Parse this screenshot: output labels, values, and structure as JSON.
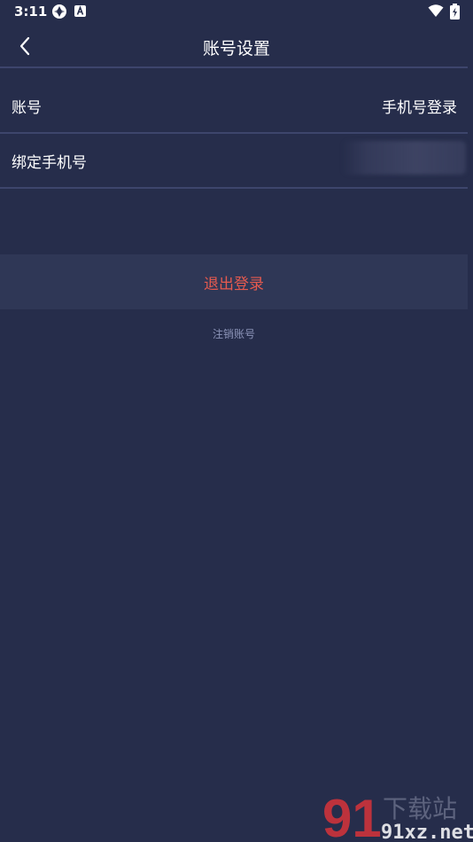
{
  "status_bar": {
    "time": "3:11",
    "icons": [
      "aperture-icon",
      "a-badge-icon",
      "wifi-icon",
      "battery-charging-icon"
    ]
  },
  "header": {
    "title": "账号设置",
    "back_icon": "chevron-left-icon"
  },
  "settings": {
    "account": {
      "label": "账号",
      "value": "手机号登录"
    },
    "bind_phone": {
      "label": "绑定手机号",
      "value_obscured": true
    }
  },
  "actions": {
    "logout_label": "退出登录",
    "cancel_account_label": "注销账号"
  },
  "watermark": {
    "logo_text": "91",
    "site_text": "91xz.net",
    "title_text": "下载站"
  },
  "colors": {
    "background": "#262d4b",
    "divider": "#3d456c",
    "button_bg": "#2f3756",
    "logout_text": "#e65a4f",
    "link_text": "#8c94b8"
  }
}
